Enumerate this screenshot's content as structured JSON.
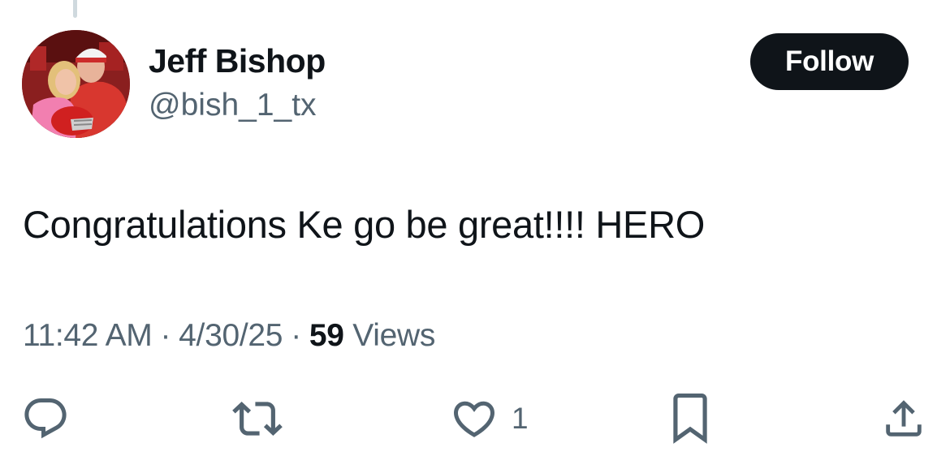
{
  "tweet": {
    "author": {
      "name": "Jeff Bishop",
      "handle": "@bish_1_tx"
    },
    "follow_label": "Follow",
    "text": "Congratulations Ke go be great!!!! HERO",
    "meta": {
      "time": "11:42 AM",
      "separator": "·",
      "date": "4/30/25",
      "views_count": "59",
      "views_label": "Views"
    },
    "actions": {
      "reply": {
        "icon": "reply-icon"
      },
      "repost": {
        "icon": "repost-icon"
      },
      "like": {
        "icon": "heart-icon",
        "count": "1"
      },
      "bookmark": {
        "icon": "bookmark-icon"
      },
      "share": {
        "icon": "share-icon"
      }
    }
  },
  "colors": {
    "text_primary": "#0f1419",
    "text_secondary": "#536471",
    "follow_bg": "#0f1419",
    "follow_text": "#ffffff",
    "background": "#ffffff"
  }
}
